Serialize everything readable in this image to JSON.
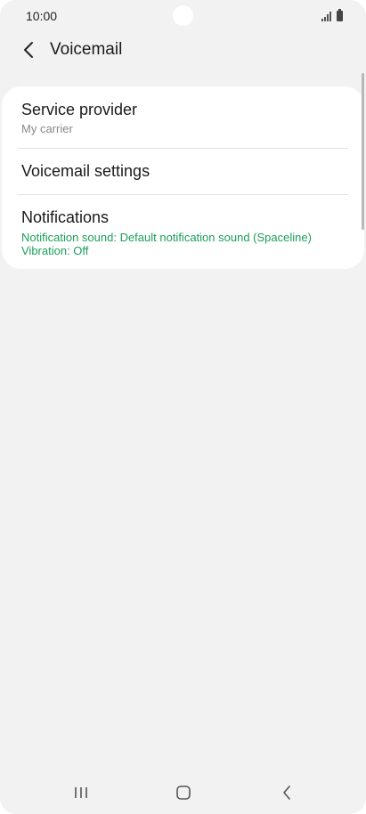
{
  "status_bar": {
    "time": "10:00"
  },
  "header": {
    "title": "Voicemail",
    "back_icon": "chevron-left-icon"
  },
  "settings": {
    "items": [
      {
        "title": "Service provider",
        "subtitle": "My carrier",
        "subtitle_color": "#888888"
      },
      {
        "title": "Voicemail settings"
      },
      {
        "title": "Notifications",
        "subtitle_lines": [
          "Notification sound: Default notification sound (Spaceline)",
          "Vibration: Off"
        ],
        "subtitle_color": "#1b9e5a"
      }
    ]
  },
  "nav_bar": {
    "icons": [
      "recent-apps-icon",
      "home-icon",
      "back-icon"
    ]
  },
  "colors": {
    "background": "#f2f2f2",
    "card": "#ffffff",
    "accent_green": "#1b9e5a"
  }
}
